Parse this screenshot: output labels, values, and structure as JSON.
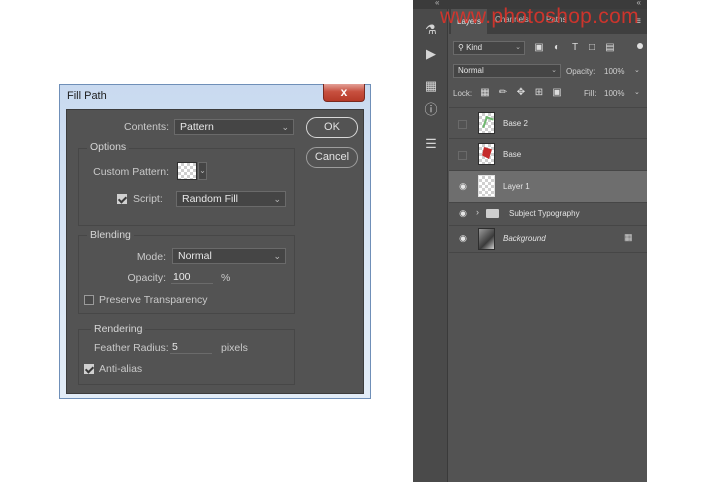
{
  "dialog": {
    "title": "Fill Path",
    "close_label": "x",
    "contents_label": "Contents:",
    "contents_value": "Pattern",
    "ok_label": "OK",
    "cancel_label": "Cancel",
    "options": {
      "title": "Options",
      "custom_pattern_label": "Custom Pattern:",
      "script_label": "Script:",
      "script_checked": true,
      "script_value": "Random Fill"
    },
    "blending": {
      "title": "Blending",
      "mode_label": "Mode:",
      "mode_value": "Normal",
      "opacity_label": "Opacity:",
      "opacity_value": "100",
      "opacity_unit": "%",
      "preserve_label": "Preserve Transparency",
      "preserve_checked": false
    },
    "rendering": {
      "title": "Rendering",
      "feather_label": "Feather Radius:",
      "feather_value": "5",
      "feather_unit": "pixels",
      "antialias_label": "Anti-alias",
      "antialias_checked": true
    }
  },
  "layers_panel": {
    "tabs": [
      "Layers",
      "Channels",
      "Paths"
    ],
    "active_tab": "Layers",
    "filter_kind": "Kind",
    "blend_mode": "Normal",
    "opacity_label": "Opacity:",
    "opacity_value": "100%",
    "lock_label": "Lock:",
    "fill_label": "Fill:",
    "fill_value": "100%",
    "layers": [
      {
        "name": "Base 2",
        "visible": false,
        "selected": false
      },
      {
        "name": "Base",
        "visible": false,
        "selected": false
      },
      {
        "name": "Layer 1",
        "visible": true,
        "selected": true
      },
      {
        "name": "Subject Typography",
        "visible": true,
        "selected": false,
        "type": "group"
      },
      {
        "name": "Background",
        "visible": true,
        "selected": false,
        "locked": true
      }
    ]
  },
  "watermark": "www.photoshop.com",
  "colors": {
    "panel_bg": "#535353",
    "dialog_frame": "#c9daf0",
    "close_red": "#c7503f",
    "selected_row": "#6e6e6e",
    "watermark_red": "#d9342b"
  }
}
